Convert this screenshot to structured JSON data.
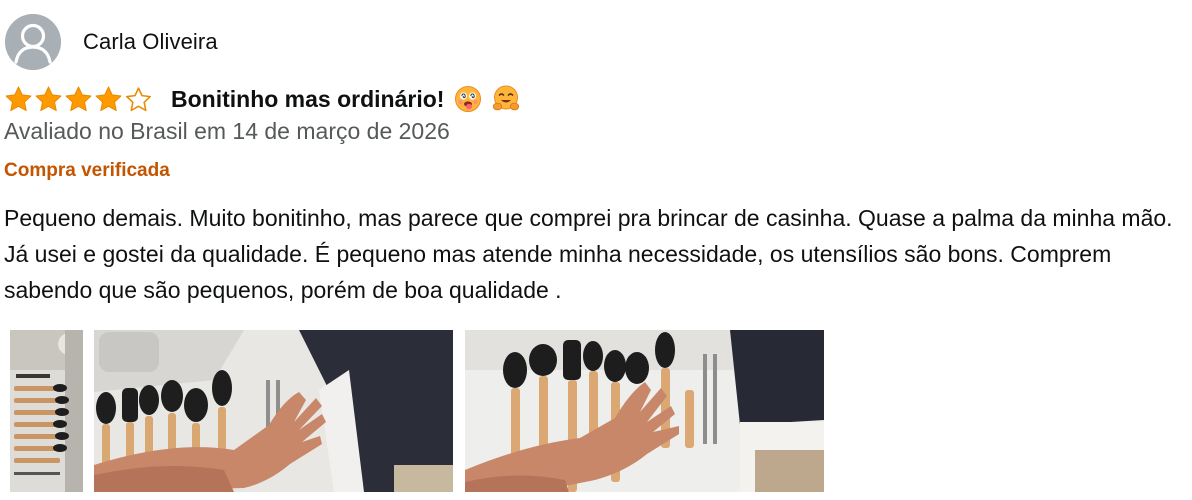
{
  "review": {
    "reviewer_name": "Carla Oliveira",
    "avatar_icon": "default-user-avatar-icon",
    "rating": 4,
    "max_rating": 5,
    "star_color": "#ff9900",
    "title": "Bonitinho mas ordinário!",
    "title_emojis": [
      "dizzy-face-tongue-emoji",
      "hugging-face-emoji"
    ],
    "date_text": "Avaliado no Brasil em 14 de março de 2026",
    "verified_label": "Compra verificada",
    "verified_color": "#c45500",
    "body": "Pequeno demais. Muito bonitinho, mas parece que comprei pra brincar de casinha. Quase a palma da minha mão. Já usei e gostei da qualidade. É pequeno mas atende minha necessidade, os utensílios são bons. Comprem sabendo que são pequenos, porém de boa qualidade ."
  },
  "photos": [
    {
      "name": "review-photo-1",
      "subject": "utensil-set-on-stand"
    },
    {
      "name": "review-photo-2",
      "subject": "hand-over-utensils"
    },
    {
      "name": "review-photo-3",
      "subject": "hand-over-utensils"
    }
  ]
}
